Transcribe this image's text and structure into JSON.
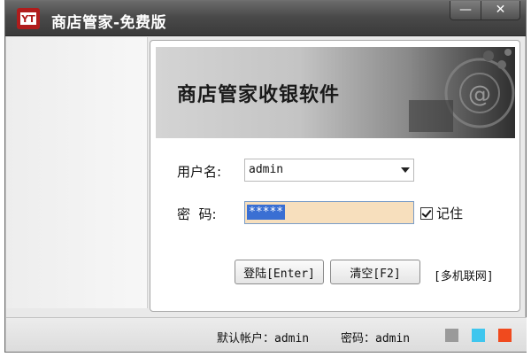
{
  "window": {
    "title": "商店管家-免费版",
    "minimize_label": "—",
    "close_label": "✕"
  },
  "banner": {
    "title": "商店管家收银软件"
  },
  "form": {
    "username_label": "用户名:",
    "username_value": "admin",
    "password_label": "密  码:",
    "password_value": "*****",
    "remember_label": "记住",
    "remember_checked": true,
    "login_button": "登陆[Enter]",
    "clear_button": "清空[F2]",
    "multi_link": "[多机联网]"
  },
  "status": {
    "default_account": "默认帐户：admin",
    "default_password": "密码：admin",
    "theme_colors": [
      "#9a9a9a",
      "#3fc6ee",
      "#f04a1e"
    ]
  },
  "colors": {
    "titlebar": "#4a4a4a",
    "password_bg": "#f7dfbd",
    "selection": "#3a6fd3"
  }
}
